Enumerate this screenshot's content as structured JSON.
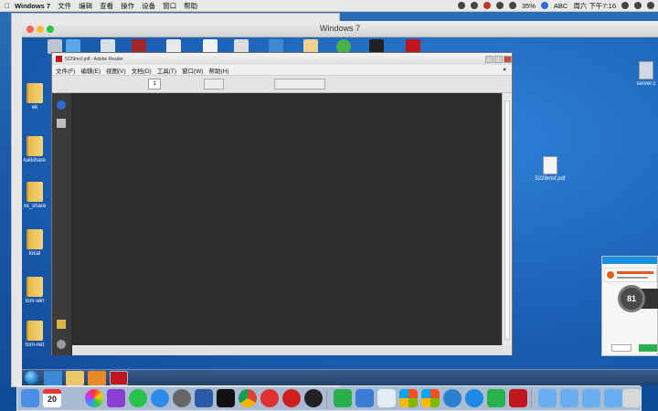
{
  "mac_menubar": {
    "app_name": "Windows 7",
    "items": [
      "文件",
      "编辑",
      "查看",
      "操作",
      "设备",
      "窗口",
      "帮助"
    ],
    "battery": "35%",
    "input_method": "ABC",
    "clock": "周六 下午7:16"
  },
  "vm_window": {
    "title": "Windows 7"
  },
  "desktop": {
    "icons": [
      {
        "label": "回收站"
      },
      {
        "label": "ek"
      },
      {
        "label": "kalishare"
      },
      {
        "label": "xx_share"
      },
      {
        "label": "local"
      },
      {
        "label": "tom-win"
      },
      {
        "label": "tom-net"
      }
    ],
    "file_icon": "5229msf.pdf",
    "server_icon": "server.c"
  },
  "reader": {
    "title": "5229msf.pdf - Adobe Reader",
    "menu": [
      "文件(F)",
      "编辑(E)",
      "视图(V)",
      "文档(D)",
      "工具(T)",
      "窗口(W)",
      "帮助(H)"
    ],
    "close_doc": "×",
    "page_number": "1"
  },
  "popup": {
    "gauge_value": "81"
  },
  "colors": {
    "accent": "#1a8fe0",
    "pdf_red": "#c0161c",
    "reader_dark": "#2e2e2e"
  }
}
